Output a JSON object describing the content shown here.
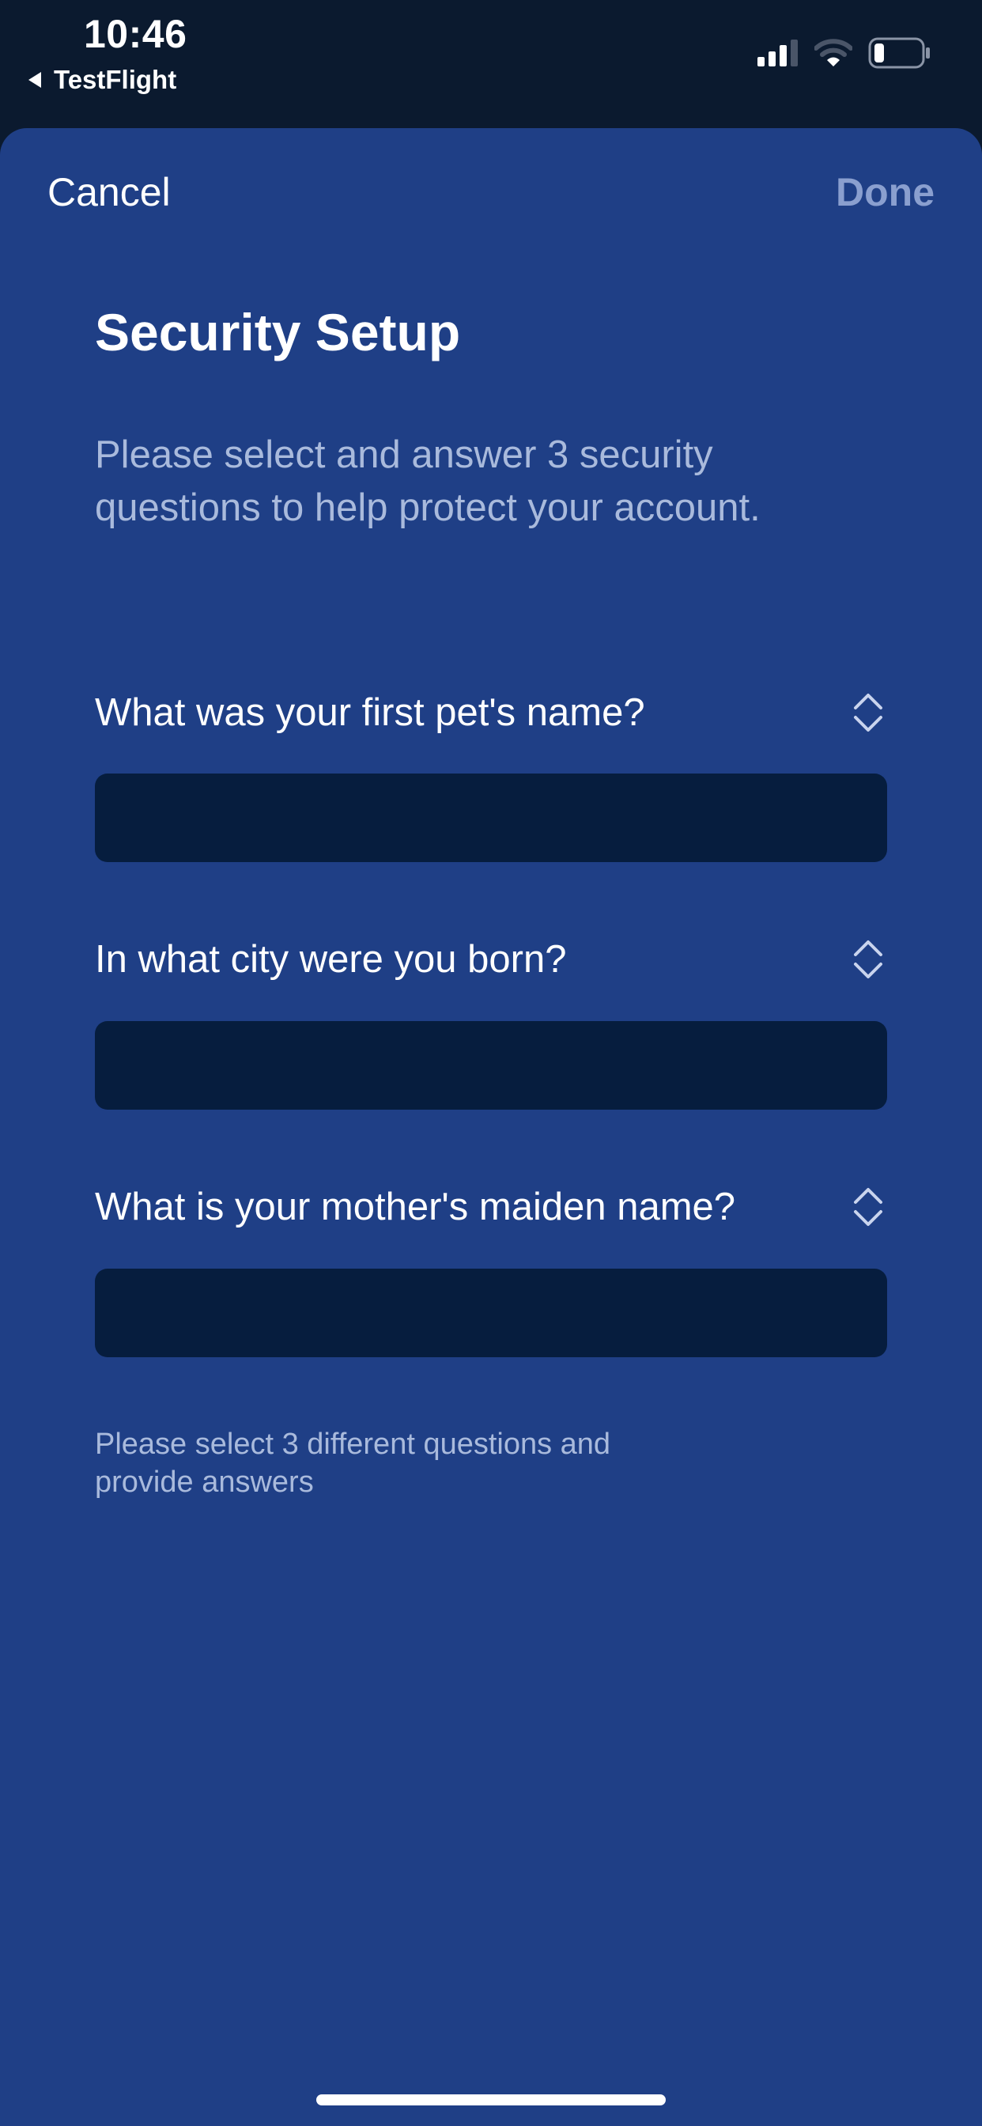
{
  "status_bar": {
    "time": "10:46",
    "back_app": "TestFlight"
  },
  "nav": {
    "cancel_label": "Cancel",
    "done_label": "Done"
  },
  "page": {
    "title": "Security Setup",
    "subtitle": "Please select and answer 3 security questions to help protect your account."
  },
  "questions": [
    {
      "label": "What was your first pet's name?",
      "answer": ""
    },
    {
      "label": "In what city were you born?",
      "answer": ""
    },
    {
      "label": "What is your mother's maiden name?",
      "answer": ""
    }
  ],
  "hint": "Please select 3 different questions and provide answers",
  "colors": {
    "sheet_background": "#1f3f86",
    "status_background": "#0b1a2f",
    "field_background": "#061d3e",
    "done_disabled": "#8a9fcf",
    "secondary_text": "#a9badc"
  },
  "icons": {
    "back": "back-triangle-icon",
    "signal": "cellular-signal-icon",
    "wifi": "wifi-icon",
    "battery": "battery-icon",
    "question_picker": "chevron-up-down-icon"
  }
}
